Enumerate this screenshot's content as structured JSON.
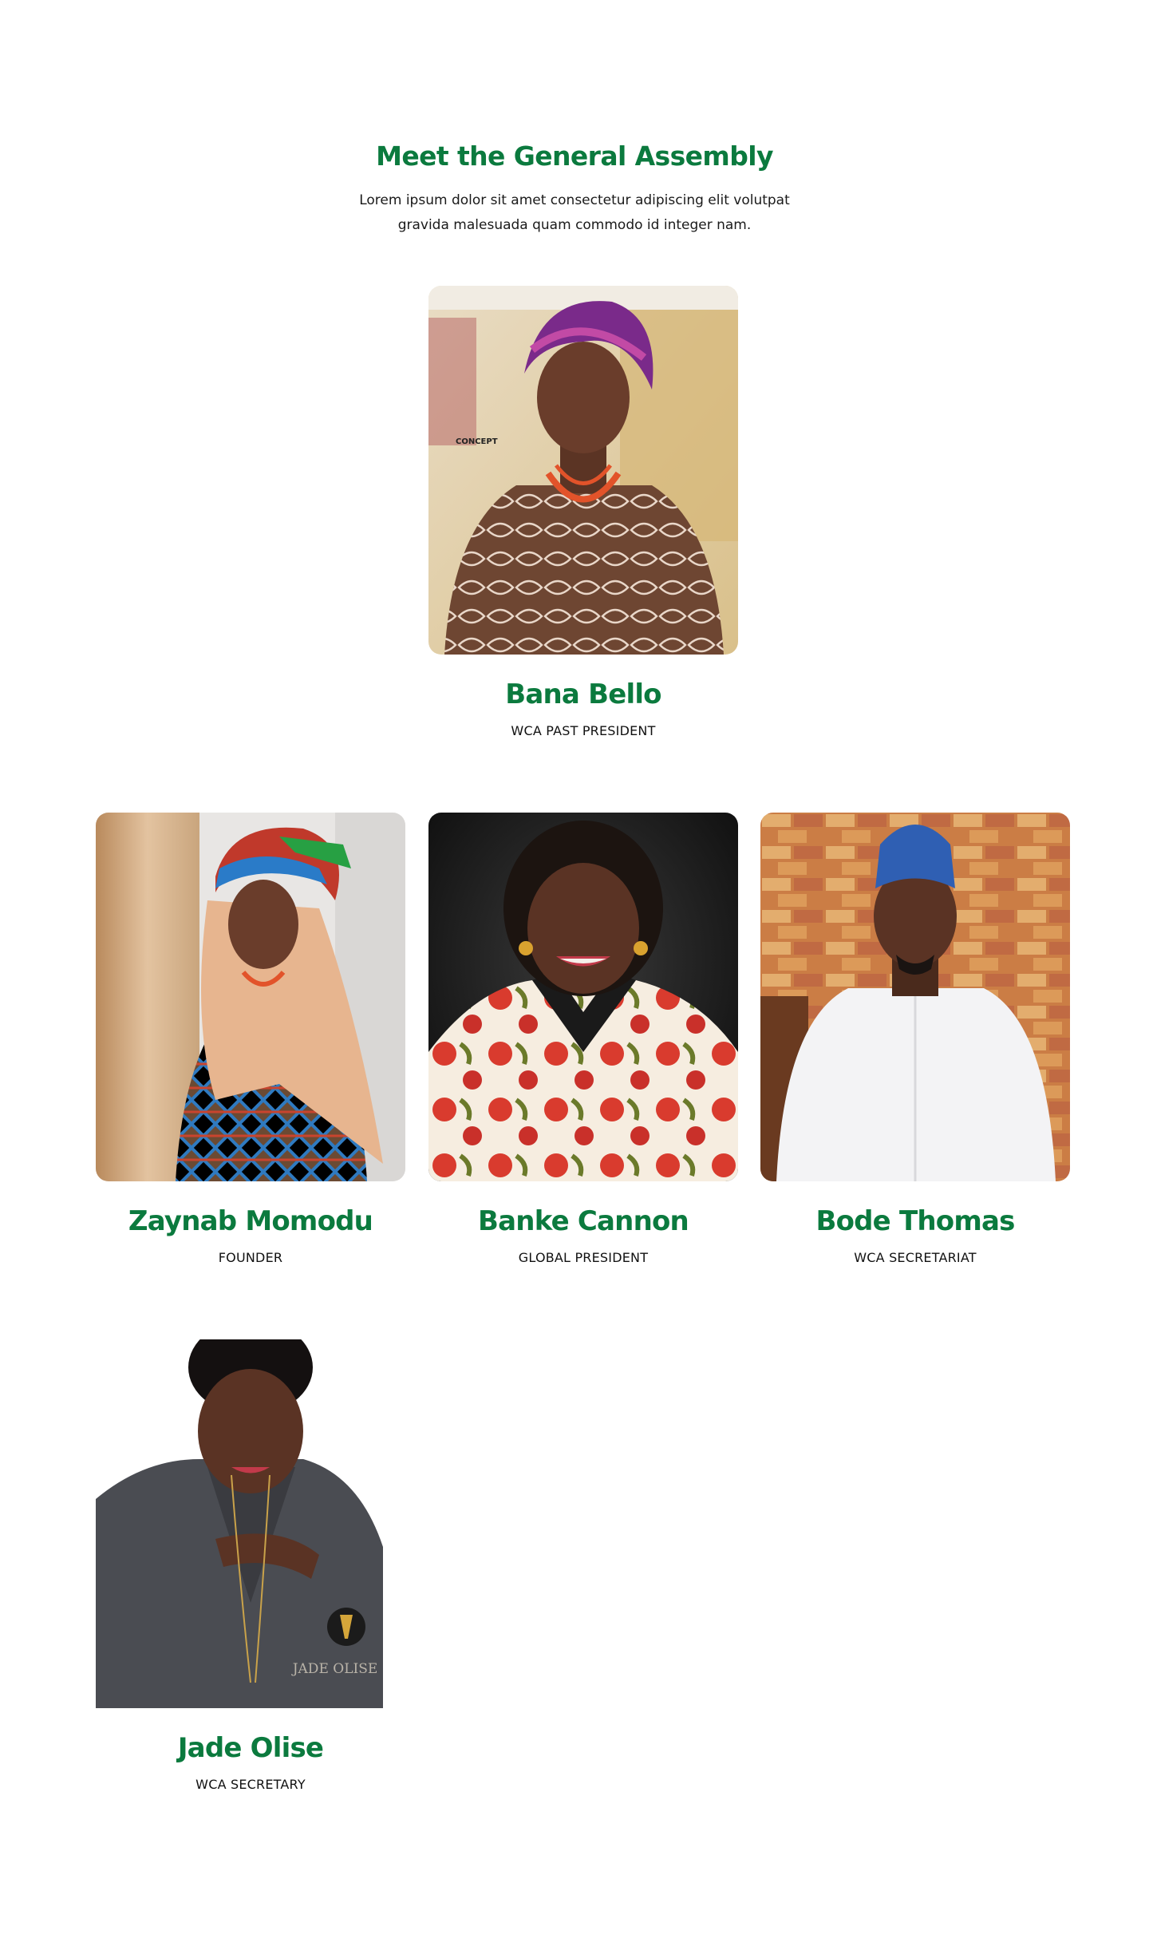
{
  "theme": {
    "accent": "#0b7a3e",
    "text": "#111111",
    "background": "#ffffff"
  },
  "section": {
    "title": "Meet the General Assembly",
    "description": "Lorem ipsum dolor sit amet consectetur adipiscing elit volutpat gravida malesuada quam commodo id integer nam."
  },
  "members": [
    {
      "name": "Bana Bello",
      "role": "WCA PAST PRESIDENT"
    },
    {
      "name": "Zaynab Momodu",
      "role": "FOUNDER"
    },
    {
      "name": "Banke Cannon",
      "role": "GLOBAL PRESIDENT"
    },
    {
      "name": "Bode Thomas",
      "role": "WCA SECRETARIAT"
    },
    {
      "name": "Jade Olise",
      "role": "WCA SECRETARY"
    }
  ],
  "photo_watermarks": {
    "bana": "CONCEPT",
    "jade": "JADE OLISE"
  }
}
